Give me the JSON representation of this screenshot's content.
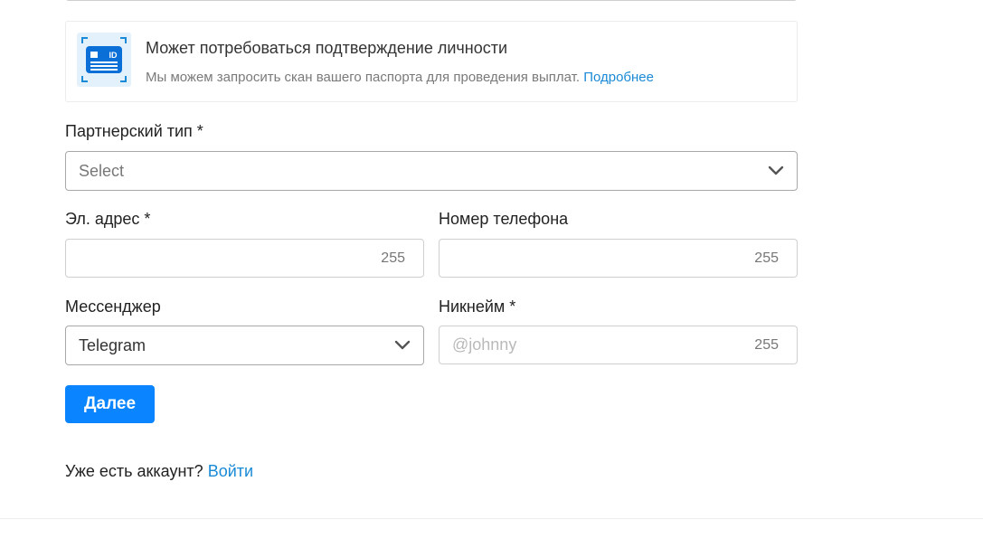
{
  "identity_notice": {
    "icon": "id-card-icon",
    "icon_text": "ID",
    "title": "Может потребоваться подтверждение личности",
    "text": "Мы можем запросить скан вашего паспорта для проведения выплат.",
    "link_label": "Подробнее",
    "accent_color": "#1a8ad6",
    "icon_bg_color": "#e3f1fc"
  },
  "partner_type": {
    "label": "Партнерский тип *",
    "selected": "Select"
  },
  "email": {
    "label": "Эл. адрес *",
    "value": "",
    "max_length": "255"
  },
  "phone": {
    "label": "Номер телефона",
    "value": "",
    "max_length": "255"
  },
  "messenger": {
    "label": "Мессенджер",
    "selected": "Telegram"
  },
  "nickname": {
    "label": "Никнейм *",
    "placeholder": "@johnny",
    "max_length": "255"
  },
  "next_button": {
    "label": "Далее",
    "color": "#0a84ff"
  },
  "login": {
    "prompt": "Уже есть аккаунт?",
    "link_label": "Войти"
  }
}
